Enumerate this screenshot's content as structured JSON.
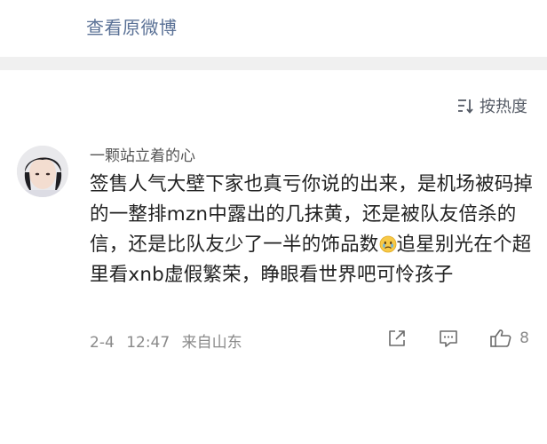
{
  "header": {
    "view_original_label": "查看原微博"
  },
  "sort": {
    "label": "按热度",
    "icon": "sort-lines-icon"
  },
  "comment": {
    "username": "一颗站立着的心",
    "text_part1": "签售人气大壁下家也真亏你说的出来，是机场被码掉的一整排mzn中露出的几抹黄，还是被队友倍杀的信，还是比队友少了一半的饰品数",
    "emoji": "crying-face",
    "text_part2": "追星别光在个超里看xnb虚假繁荣，睁眼看世界吧可怜孩子",
    "date": "2-4",
    "time": "12:47",
    "location": "来自山东",
    "like_count": "8"
  },
  "colors": {
    "link": "#5a7196",
    "separator": "#f0f0f0",
    "meta": "#8a8a8a"
  }
}
